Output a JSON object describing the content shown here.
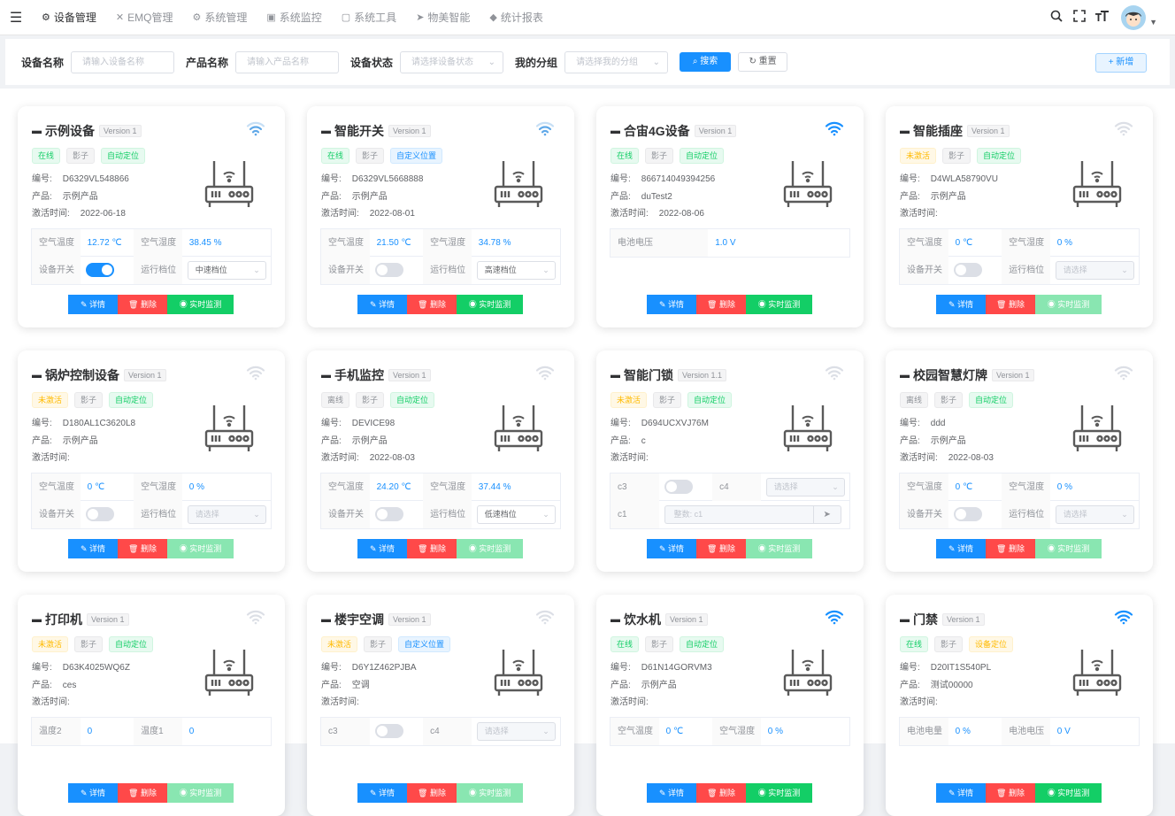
{
  "nav": {
    "items": [
      {
        "icon": "⚙",
        "label": "设备管理",
        "active": true
      },
      {
        "icon": "✕",
        "label": "EMQ管理",
        "active": false
      },
      {
        "icon": "⚙",
        "label": "系统管理",
        "active": false
      },
      {
        "icon": "▣",
        "label": "系统监控",
        "active": false
      },
      {
        "icon": "▢",
        "label": "系统工具",
        "active": false
      },
      {
        "icon": "➤",
        "label": "物美智能",
        "active": false
      },
      {
        "icon": "◆",
        "label": "统计报表",
        "active": false
      }
    ]
  },
  "search": {
    "device_name_label": "设备名称",
    "device_name_placeholder": "请输入设备名称",
    "product_name_label": "产品名称",
    "product_name_placeholder": "请输入产品名称",
    "status_label": "设备状态",
    "status_placeholder": "请选择设备状态",
    "group_label": "我的分组",
    "group_placeholder": "请选择我的分组",
    "search_btn": "搜索",
    "reset_btn": "重置",
    "add_btn": "+ 新增"
  },
  "labels": {
    "code": "编号:",
    "product": "产品:",
    "active_time": "激活时间:",
    "detail": "详情",
    "delete": "删除",
    "monitor": "实时监测"
  },
  "colors": {
    "primary": "#1890ff",
    "danger": "#ff4949",
    "success": "#13ce66",
    "warning": "#ffba00"
  },
  "cards": [
    {
      "name": "示例设备",
      "version": "Version 1",
      "wifi": "light",
      "tags": [
        [
          "在线",
          "green"
        ],
        [
          "影子",
          "gray"
        ],
        [
          "自动定位",
          "green"
        ]
      ],
      "code": "D6329VL548866",
      "product": "示例产品",
      "time": "2022-06-18",
      "mon": true,
      "rows": [
        {
          "t": "kv4",
          "a": "空气温度",
          "b": "12.72 ℃",
          "c": "空气湿度",
          "d": "38.45 %"
        },
        {
          "t": "swsel",
          "a": "设备开关",
          "on": true,
          "c": "运行档位",
          "d": "中速档位",
          "ph": false
        }
      ]
    },
    {
      "name": "智能开关",
      "version": "Version 1",
      "wifi": "light",
      "tags": [
        [
          "在线",
          "green"
        ],
        [
          "影子",
          "gray"
        ],
        [
          "自定义位置",
          "blue"
        ]
      ],
      "code": "D6329VL5668888",
      "product": "示例产品",
      "time": "2022-08-01",
      "mon": true,
      "rows": [
        {
          "t": "kv4",
          "a": "空气温度",
          "b": "21.50 ℃",
          "c": "空气湿度",
          "d": "34.78 %"
        },
        {
          "t": "swsel",
          "a": "设备开关",
          "on": false,
          "c": "运行档位",
          "d": "高速档位",
          "ph": false
        }
      ]
    },
    {
      "name": "合宙4G设备",
      "version": "Version 1",
      "wifi": "strong",
      "tags": [
        [
          "在线",
          "green"
        ],
        [
          "影子",
          "gray"
        ],
        [
          "自动定位",
          "green"
        ]
      ],
      "code": "866714049394256",
      "product": "duTest2",
      "time": "2022-08-06",
      "mon": true,
      "rows": [
        {
          "t": "kv2",
          "a": "电池电压",
          "b": "1.0 V"
        }
      ]
    },
    {
      "name": "智能插座",
      "version": "Version 1",
      "wifi": "none",
      "tags": [
        [
          "未激活",
          "orange"
        ],
        [
          "影子",
          "gray"
        ],
        [
          "自动定位",
          "green"
        ]
      ],
      "code": "D4WLA58790VU",
      "product": "示例产品",
      "time": "",
      "mon": false,
      "rows": [
        {
          "t": "kv4",
          "a": "空气温度",
          "b": "0 ℃",
          "c": "空气湿度",
          "d": "0 %"
        },
        {
          "t": "swsel",
          "a": "设备开关",
          "on": false,
          "c": "运行档位",
          "d": "请选择",
          "ph": true
        }
      ]
    },
    {
      "name": "锅炉控制设备",
      "version": "Version 1",
      "wifi": "none",
      "tags": [
        [
          "未激活",
          "orange"
        ],
        [
          "影子",
          "gray"
        ],
        [
          "自动定位",
          "green"
        ]
      ],
      "code": "D180AL1C3620L8",
      "product": "示例产品",
      "time": "",
      "mon": false,
      "rows": [
        {
          "t": "kv4",
          "a": "空气温度",
          "b": "0 ℃",
          "c": "空气湿度",
          "d": "0 %"
        },
        {
          "t": "swsel",
          "a": "设备开关",
          "on": false,
          "c": "运行档位",
          "d": "请选择",
          "ph": true
        }
      ]
    },
    {
      "name": "手机监控",
      "version": "Version 1",
      "wifi": "none",
      "tags": [
        [
          "离线",
          "gray"
        ],
        [
          "影子",
          "gray"
        ],
        [
          "自动定位",
          "green"
        ]
      ],
      "code": "DEVICE98",
      "product": "示例产品",
      "time": "2022-08-03",
      "mon": false,
      "rows": [
        {
          "t": "kv4",
          "a": "空气温度",
          "b": "24.20 ℃",
          "c": "空气湿度",
          "d": "37.44 %"
        },
        {
          "t": "swsel",
          "a": "设备开关",
          "on": false,
          "c": "运行档位",
          "d": "低速档位",
          "ph": false
        }
      ]
    },
    {
      "name": "智能门锁",
      "version": "Version 1.1",
      "wifi": "none",
      "tags": [
        [
          "未激活",
          "orange"
        ],
        [
          "影子",
          "gray"
        ],
        [
          "自动定位",
          "green"
        ]
      ],
      "code": "D694UCXVJ76M",
      "product": "c",
      "time": "",
      "mon": false,
      "rows": [
        {
          "t": "swsel",
          "a": "c3",
          "on": false,
          "c": "c4",
          "d": "请选择",
          "ph": true
        },
        {
          "t": "input",
          "a": "c1",
          "d": "整数: c1"
        }
      ]
    },
    {
      "name": "校园智慧灯牌",
      "version": "Version 1",
      "wifi": "none",
      "tags": [
        [
          "离线",
          "gray"
        ],
        [
          "影子",
          "gray"
        ],
        [
          "自动定位",
          "green"
        ]
      ],
      "code": "ddd",
      "product": "示例产品",
      "time": "2022-08-03",
      "mon": false,
      "rows": [
        {
          "t": "kv4",
          "a": "空气温度",
          "b": "0 ℃",
          "c": "空气湿度",
          "d": "0 %"
        },
        {
          "t": "swsel",
          "a": "设备开关",
          "on": false,
          "c": "运行档位",
          "d": "请选择",
          "ph": true
        }
      ]
    },
    {
      "name": "打印机",
      "version": "Version 1",
      "wifi": "none",
      "tags": [
        [
          "未激活",
          "orange"
        ],
        [
          "影子",
          "gray"
        ],
        [
          "自动定位",
          "green"
        ]
      ],
      "code": "D63K4025WQ6Z",
      "product": "ces",
      "time": "",
      "mon": false,
      "rows": [
        {
          "t": "kv4",
          "a": "温度2",
          "b": "0",
          "c": "温度1",
          "d": "0"
        }
      ]
    },
    {
      "name": "楼宇空调",
      "version": "Version 1",
      "wifi": "none",
      "tags": [
        [
          "未激活",
          "orange"
        ],
        [
          "影子",
          "gray"
        ],
        [
          "自定义位置",
          "blue"
        ]
      ],
      "code": "D6Y1Z462PJBA",
      "product": "空调",
      "time": "",
      "mon": false,
      "rows": [
        {
          "t": "swsel",
          "a": "c3",
          "on": false,
          "c": "c4",
          "d": "请选择",
          "ph": true
        }
      ]
    },
    {
      "name": "饮水机",
      "version": "Version 1",
      "wifi": "strong",
      "tags": [
        [
          "在线",
          "green"
        ],
        [
          "影子",
          "gray"
        ],
        [
          "自动定位",
          "green"
        ]
      ],
      "code": "D61N14GORVM3",
      "product": "示例产品",
      "time": "",
      "mon": true,
      "rows": [
        {
          "t": "kv4",
          "a": "空气温度",
          "b": "0 ℃",
          "c": "空气湿度",
          "d": "0 %"
        }
      ]
    },
    {
      "name": "门禁",
      "version": "Version 1",
      "wifi": "strong",
      "tags": [
        [
          "在线",
          "green"
        ],
        [
          "影子",
          "gray"
        ],
        [
          "设备定位",
          "orange"
        ]
      ],
      "code": "D20IT1S540PL",
      "product": "测试00000",
      "time": "",
      "mon": true,
      "rows": [
        {
          "t": "kv4",
          "a": "电池电量",
          "b": "0 %",
          "c": "电池电压",
          "d": "0 V"
        }
      ]
    }
  ]
}
